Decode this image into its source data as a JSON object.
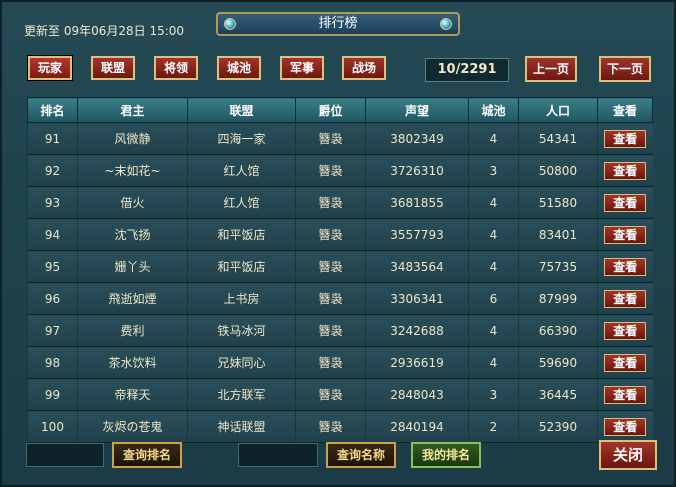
{
  "header": {
    "updated": "更新至 09年06月28日 15:00",
    "title": "排行榜"
  },
  "tabs": [
    "玩家",
    "联盟",
    "将领",
    "城池",
    "军事",
    "战场"
  ],
  "pager": {
    "page_info": "10/2291",
    "prev_label": "上一页",
    "next_label": "下一页"
  },
  "table": {
    "columns": [
      "排名",
      "君主",
      "联盟",
      "爵位",
      "声望",
      "城池",
      "人口",
      "查看"
    ],
    "rows": [
      [
        "91",
        "风微静",
        "四海一家",
        "簪袅",
        "3802349",
        "4",
        "54341",
        "查看"
      ],
      [
        "92",
        "~末如花~",
        "红人馆",
        "簪袅",
        "3726310",
        "3",
        "50800",
        "查看"
      ],
      [
        "93",
        "借火",
        "红人馆",
        "簪袅",
        "3681855",
        "4",
        "51580",
        "查看"
      ],
      [
        "94",
        "沈飞扬",
        "和平饭店",
        "簪袅",
        "3557793",
        "4",
        "83401",
        "查看"
      ],
      [
        "95",
        "姗丫头",
        "和平饭店",
        "簪袅",
        "3483564",
        "4",
        "75735",
        "查看"
      ],
      [
        "96",
        "飛逝如煙",
        "上书房",
        "簪袅",
        "3306341",
        "6",
        "87999",
        "查看"
      ],
      [
        "97",
        "费利",
        "铁马冰河",
        "簪袅",
        "3242688",
        "4",
        "66390",
        "查看"
      ],
      [
        "98",
        "茶水饮料",
        "兄妹同心",
        "簪袅",
        "2936619",
        "4",
        "59690",
        "查看"
      ],
      [
        "99",
        "帝释天",
        "北方联军",
        "簪袅",
        "2848043",
        "3",
        "36445",
        "查看"
      ],
      [
        "100",
        "灰烬の苍鬼",
        "神话联盟",
        "簪袅",
        "2840194",
        "2",
        "52390",
        "查看"
      ]
    ]
  },
  "footer": {
    "rank_search_label": "查询排名",
    "name_search_label": "查询名称",
    "my_rank_label": "我的排名",
    "close_label": "关闭"
  }
}
